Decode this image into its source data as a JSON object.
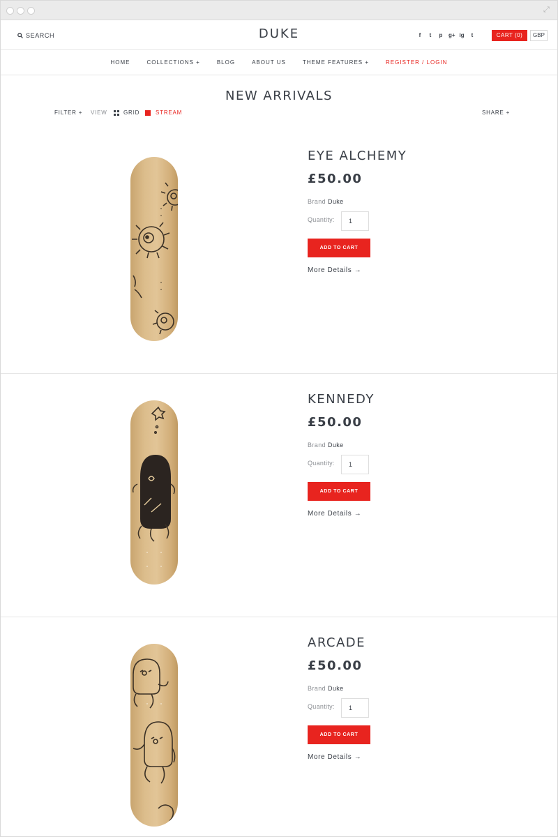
{
  "header": {
    "search_label": "SEARCH",
    "logo": "DUKE",
    "social": [
      "f",
      "t",
      "p",
      "g+",
      "ig",
      "t"
    ],
    "cart_label": "CART (0)",
    "currency": "GBP"
  },
  "nav": {
    "items": [
      "HOME",
      "COLLECTIONS +",
      "BLOG",
      "ABOUT US",
      "THEME FEATURES +",
      "REGISTER / LOGIN"
    ]
  },
  "collection": {
    "title": "NEW ARRIVALS",
    "filter_label": "FILTER +",
    "view_label": "VIEW",
    "grid_label": "GRID",
    "stream_label": "STREAM",
    "share_label": "SHARE +"
  },
  "products": [
    {
      "name": "EYE ALCHEMY",
      "price": "£50.00",
      "brand_label": "Brand",
      "brand": "Duke",
      "quantity_label": "Quantity:",
      "quantity": "1",
      "add_label": "ADD TO CART",
      "more_label": "More Details →"
    },
    {
      "name": "KENNEDY",
      "price": "£50.00",
      "brand_label": "Brand",
      "brand": "Duke",
      "quantity_label": "Quantity:",
      "quantity": "1",
      "add_label": "ADD TO CART",
      "more_label": "More Details →"
    },
    {
      "name": "ARCADE",
      "price": "£50.00",
      "brand_label": "Brand",
      "brand": "Duke",
      "quantity_label": "Quantity:",
      "quantity": "1",
      "add_label": "ADD TO CART",
      "more_label": "More Details →"
    }
  ],
  "colors": {
    "accent": "#e8241f",
    "text": "#3a3f47",
    "muted": "#8a8d92"
  }
}
